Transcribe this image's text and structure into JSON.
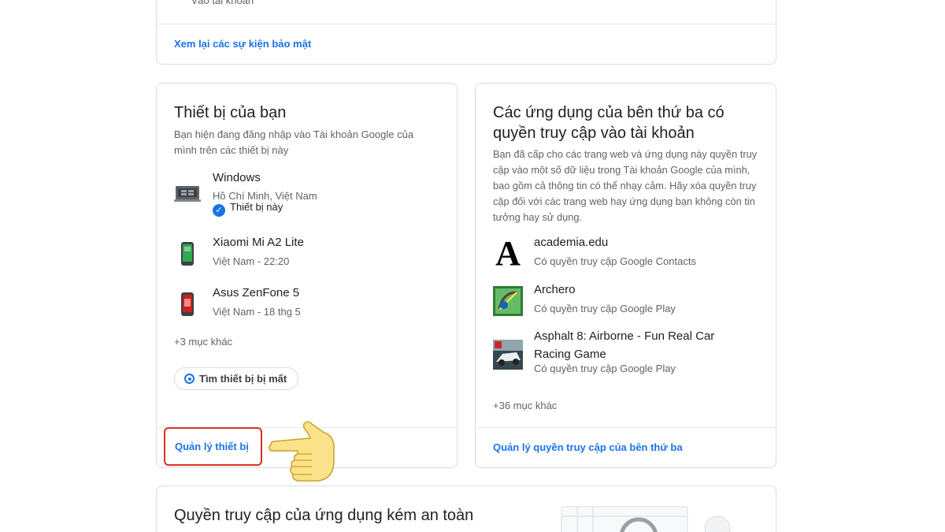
{
  "security_card": {
    "clipped_text": "Vào tài khoản",
    "review_link": "Xem lại các sự kiện bảo mật"
  },
  "devices_card": {
    "title": "Thiết bị của bạn",
    "description": "Bạn hiện đang đăng nhập vào Tài khoản Google của mình trên các thiết bị này",
    "devices": [
      {
        "name": "Windows",
        "sub": "Hồ Chí Minh, Việt Nam",
        "badge": "Thiết bị này",
        "icon": "laptop-icon"
      },
      {
        "name": "Xiaomi Mi A2 Lite",
        "sub": "Việt Nam - 22:20",
        "icon": "phone-icon"
      },
      {
        "name": "Asus ZenFone 5",
        "sub": "Việt Nam - 18 thg 5",
        "icon": "phone-icon"
      }
    ],
    "more": "+3 mục khác",
    "find_button": "Tìm thiết bị bị mất",
    "manage_link": "Quản lý thiết bị"
  },
  "apps_card": {
    "title": "Các ứng dụng của bên thứ ba có quyền truy cập vào tài khoản",
    "description": "Bạn đã cấp cho các trang web và ứng dụng này quyền truy cập vào một số dữ liệu trong Tài khoản Google của mình, bao gồm cả thông tin có thể nhạy cảm. Hãy xóa quyền truy cập đối với các trang web hay ứng dụng bạn không còn tin tưởng hay sử dụng.",
    "apps": [
      {
        "name": "academia.edu",
        "sub": "Có quyền truy cập Google Contacts",
        "logo_letter": "A"
      },
      {
        "name": "Archero",
        "sub": "Có quyền truy cập Google Play"
      },
      {
        "name": "Asphalt 8: Airborne - Fun Real Car Racing Game",
        "sub": "Có quyền truy cập Google Play"
      }
    ],
    "more": "+36 mục khác",
    "manage_link": "Quản lý quyền truy cập của bên thứ ba"
  },
  "less_secure_card": {
    "title": "Quyền truy cập của ứng dụng kém an toàn"
  },
  "colors": {
    "link": "#1a73e8",
    "highlight_border": "#d93025",
    "hand": "#fbe28a"
  }
}
